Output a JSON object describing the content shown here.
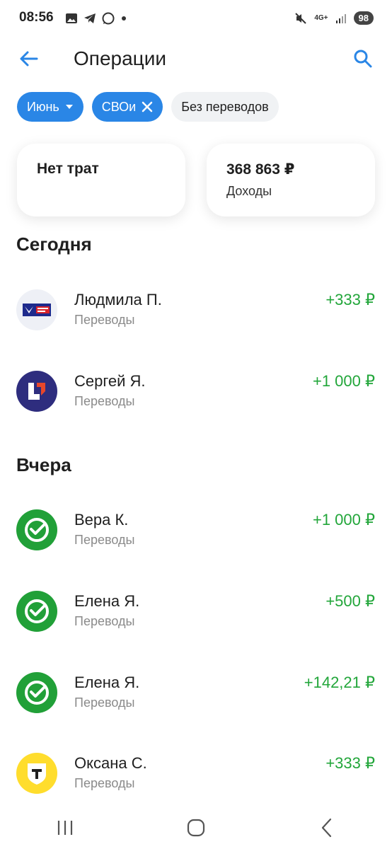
{
  "status_bar": {
    "time": "08:56",
    "network": "4G+",
    "battery": "98"
  },
  "header": {
    "title": "Операции"
  },
  "filters": {
    "month_chip": "Июнь",
    "tag_chip": "СВОи",
    "transfers_chip": "Без переводов"
  },
  "summary": {
    "spending_label": "Нет трат",
    "income_amount": "368 863 ₽",
    "income_label": "Доходы"
  },
  "sections": {
    "today": "Сегодня",
    "yesterday": "Вчера"
  },
  "transactions": [
    {
      "name": "Людмила П.",
      "category": "Переводы",
      "amount": "+333 ₽",
      "bank_icon": "pochta-bank-icon"
    },
    {
      "name": "Сергей Я.",
      "category": "Переводы",
      "amount": "+1 000 ₽",
      "bank_icon": "bank-logo-icon"
    },
    {
      "name": "Вера К.",
      "category": "Переводы",
      "amount": "+1 000 ₽",
      "bank_icon": "sber-icon"
    },
    {
      "name": "Елена Я.",
      "category": "Переводы",
      "amount": "+500 ₽",
      "bank_icon": "sber-icon"
    },
    {
      "name": "Елена Я.",
      "category": "Переводы",
      "amount": "+142,21 ₽",
      "bank_icon": "sber-icon"
    },
    {
      "name": "Оксана С.",
      "category": "Переводы",
      "amount": "+333 ₽",
      "bank_icon": "tbank-icon"
    }
  ],
  "colors": {
    "accent": "#2a86e6",
    "income_green": "#22a63a",
    "sber_green": "#21a038",
    "pochta_blue": "#1e2a8c",
    "tbank_yellow": "#ffdd2d"
  }
}
